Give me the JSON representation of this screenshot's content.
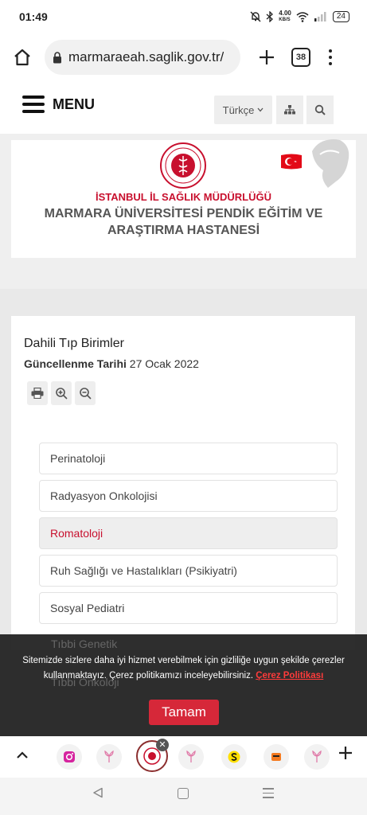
{
  "status_bar": {
    "time": "01:49",
    "net_speed": "4.00",
    "net_unit": "KB/S",
    "battery": "24"
  },
  "browser": {
    "url": "marmaraeah.saglik.gov.tr/",
    "tab_count": "38"
  },
  "site_header": {
    "menu_label": "MENU",
    "language": "Türkçe"
  },
  "banner": {
    "org_line1": "İSTANBUL İL SAĞLIK MÜDÜRLÜĞÜ",
    "org_line2": "MARMARA ÜNİVERSİTESİ PENDİK EĞİTİM VE ARAŞTIRMA HASTANESİ"
  },
  "content": {
    "title": "Dahili Tıp Birimler",
    "updated_label": "Güncellenme Tarihi",
    "updated_date": "27 Ocak 2022",
    "items": [
      {
        "label": "Perinatoloji",
        "active": false
      },
      {
        "label": "Radyasyon Onkolojisi",
        "active": false
      },
      {
        "label": "Romatoloji",
        "active": true
      },
      {
        "label": "Ruh Sağlığı ve Hastalıkları (Psikiyatri)",
        "active": false
      },
      {
        "label": "Sosyal Pediatri",
        "active": false
      }
    ],
    "hidden_items": [
      "Tıbbi Genetik",
      "Tıbbi Onkoloji"
    ]
  },
  "cookie": {
    "message": "Sitemizde sizlere daha iyi hizmet verebilmek için gizliliğe uygun şekilde çerezler kullanmaktayız. Çerez politikamızı inceleyebilirsiniz.",
    "policy_link": "Çerez Politikası",
    "accept_label": "Tamam"
  },
  "colors": {
    "brand_red": "#c8102e",
    "cookie_button": "#d62839"
  }
}
